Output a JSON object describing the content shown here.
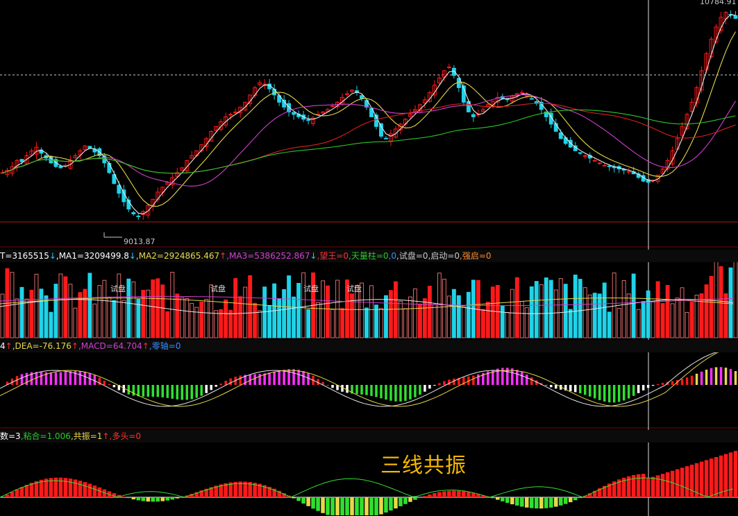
{
  "colors": {
    "up": "#ff1a1a",
    "down": "#1fd3e8",
    "ma_white": "#e8e8e8",
    "ma_yellow": "#e6d84a",
    "ma_magenta": "#d040d0",
    "ma_green": "#28c828",
    "ma_red": "#e02020",
    "grid": "#8a1010"
  },
  "price_panel": {
    "high_label": "10784.91",
    "low_label": "9013.87"
  },
  "volume_header": {
    "items": [
      {
        "text": "T=3165515",
        "arrow": "↓",
        "color": "#ffffff"
      },
      {
        "text": ",MA1=3209499.8",
        "arrow": "↓",
        "color": "#ffffff"
      },
      {
        "text": ",MA2=2924865.467",
        "arrow": "↑",
        "color": "#e6d84a"
      },
      {
        "text": ",MA3=5386252.867",
        "arrow": "↓",
        "color": "#d040d0"
      },
      {
        "text": ",望王=0",
        "arrow": "",
        "color": "#ff3030"
      },
      {
        "text": ",天量柱=0",
        "arrow": "",
        "color": "#28c828"
      },
      {
        "text": ",0",
        "arrow": "",
        "color": "#3a8cff"
      },
      {
        "text": ",试盘=0",
        "arrow": "",
        "color": "#c8c8c8"
      },
      {
        "text": ",启动=0",
        "arrow": "",
        "color": "#c8c8c8"
      },
      {
        "text": ",强启=0",
        "arrow": "",
        "color": "#ff8a30"
      }
    ],
    "annotations": [
      "试盘",
      "试盘",
      "试盘",
      "试盘"
    ]
  },
  "macd_header": {
    "items": [
      {
        "text": "4",
        "arrow": "↑",
        "color": "#ffffff"
      },
      {
        "text": ",DEA=-76.176",
        "arrow": "↑",
        "color": "#e6d84a"
      },
      {
        "text": ",MACD=64.704",
        "arrow": "↑",
        "color": "#d040d0"
      },
      {
        "text": ",零轴=0",
        "arrow": "",
        "color": "#3a8cff"
      }
    ]
  },
  "resonance_header": {
    "items": [
      {
        "text": "数=3",
        "arrow": "",
        "color": "#ffffff"
      },
      {
        "text": ",粘合=1.006",
        "arrow": "",
        "color": "#28c828"
      },
      {
        "text": ",共振=1",
        "arrow": "↑",
        "color": "#e6d84a"
      },
      {
        "text": ",多头=0",
        "arrow": "",
        "color": "#ff3030"
      }
    ],
    "title": "三线共振"
  },
  "chart_data": {
    "type": "candlestick",
    "price_range": [
      9013.87,
      10784.91
    ],
    "close_series": [
      9420,
      9440,
      9470,
      9520,
      9510,
      9560,
      9600,
      9630,
      9580,
      9540,
      9500,
      9470,
      9460,
      9480,
      9520,
      9560,
      9600,
      9640,
      9620,
      9590,
      9560,
      9500,
      9420,
      9330,
      9250,
      9180,
      9120,
      9080,
      9060,
      9100,
      9150,
      9200,
      9260,
      9300,
      9340,
      9380,
      9420,
      9460,
      9520,
      9560,
      9600,
      9650,
      9700,
      9760,
      9800,
      9840,
      9880,
      9900,
      9920,
      9960,
      10000,
      10060,
      10120,
      10160,
      10150,
      10110,
      10060,
      10000,
      9960,
      9920,
      9900,
      9880,
      9860,
      9850,
      9870,
      9900,
      9920,
      9940,
      9970,
      10000,
      10040,
      10070,
      10100,
      10080,
      10030,
      9960,
      9880,
      9800,
      9720,
      9700,
      9740,
      9780,
      9820,
      9860,
      9900,
      9940,
      9980,
      10020,
      10080,
      10140,
      10200,
      10260,
      10290,
      10220,
      10120,
      10000,
      9920,
      9880,
      9900,
      9940,
      9980,
      10010,
      10040,
      10030,
      10020,
      10050,
      10070,
      10080,
      10060,
      10030,
      9990,
      9940,
      9880,
      9820,
      9760,
      9700,
      9660,
      9630,
      9600,
      9580,
      9560,
      9540,
      9520,
      9500,
      9480,
      9470,
      9460,
      9450,
      9440,
      9430,
      9410,
      9380,
      9350,
      9340,
      9360,
      9400,
      9450,
      9520,
      9600,
      9700,
      9800,
      9900,
      10000,
      10120,
      10260,
      10400,
      10520,
      10620,
      10700,
      10740,
      10720,
      10690
    ],
    "volume_colors_note": "up/down/trial columns",
    "macd": {
      "DEA": -76.176,
      "MACD": 64.704
    }
  }
}
